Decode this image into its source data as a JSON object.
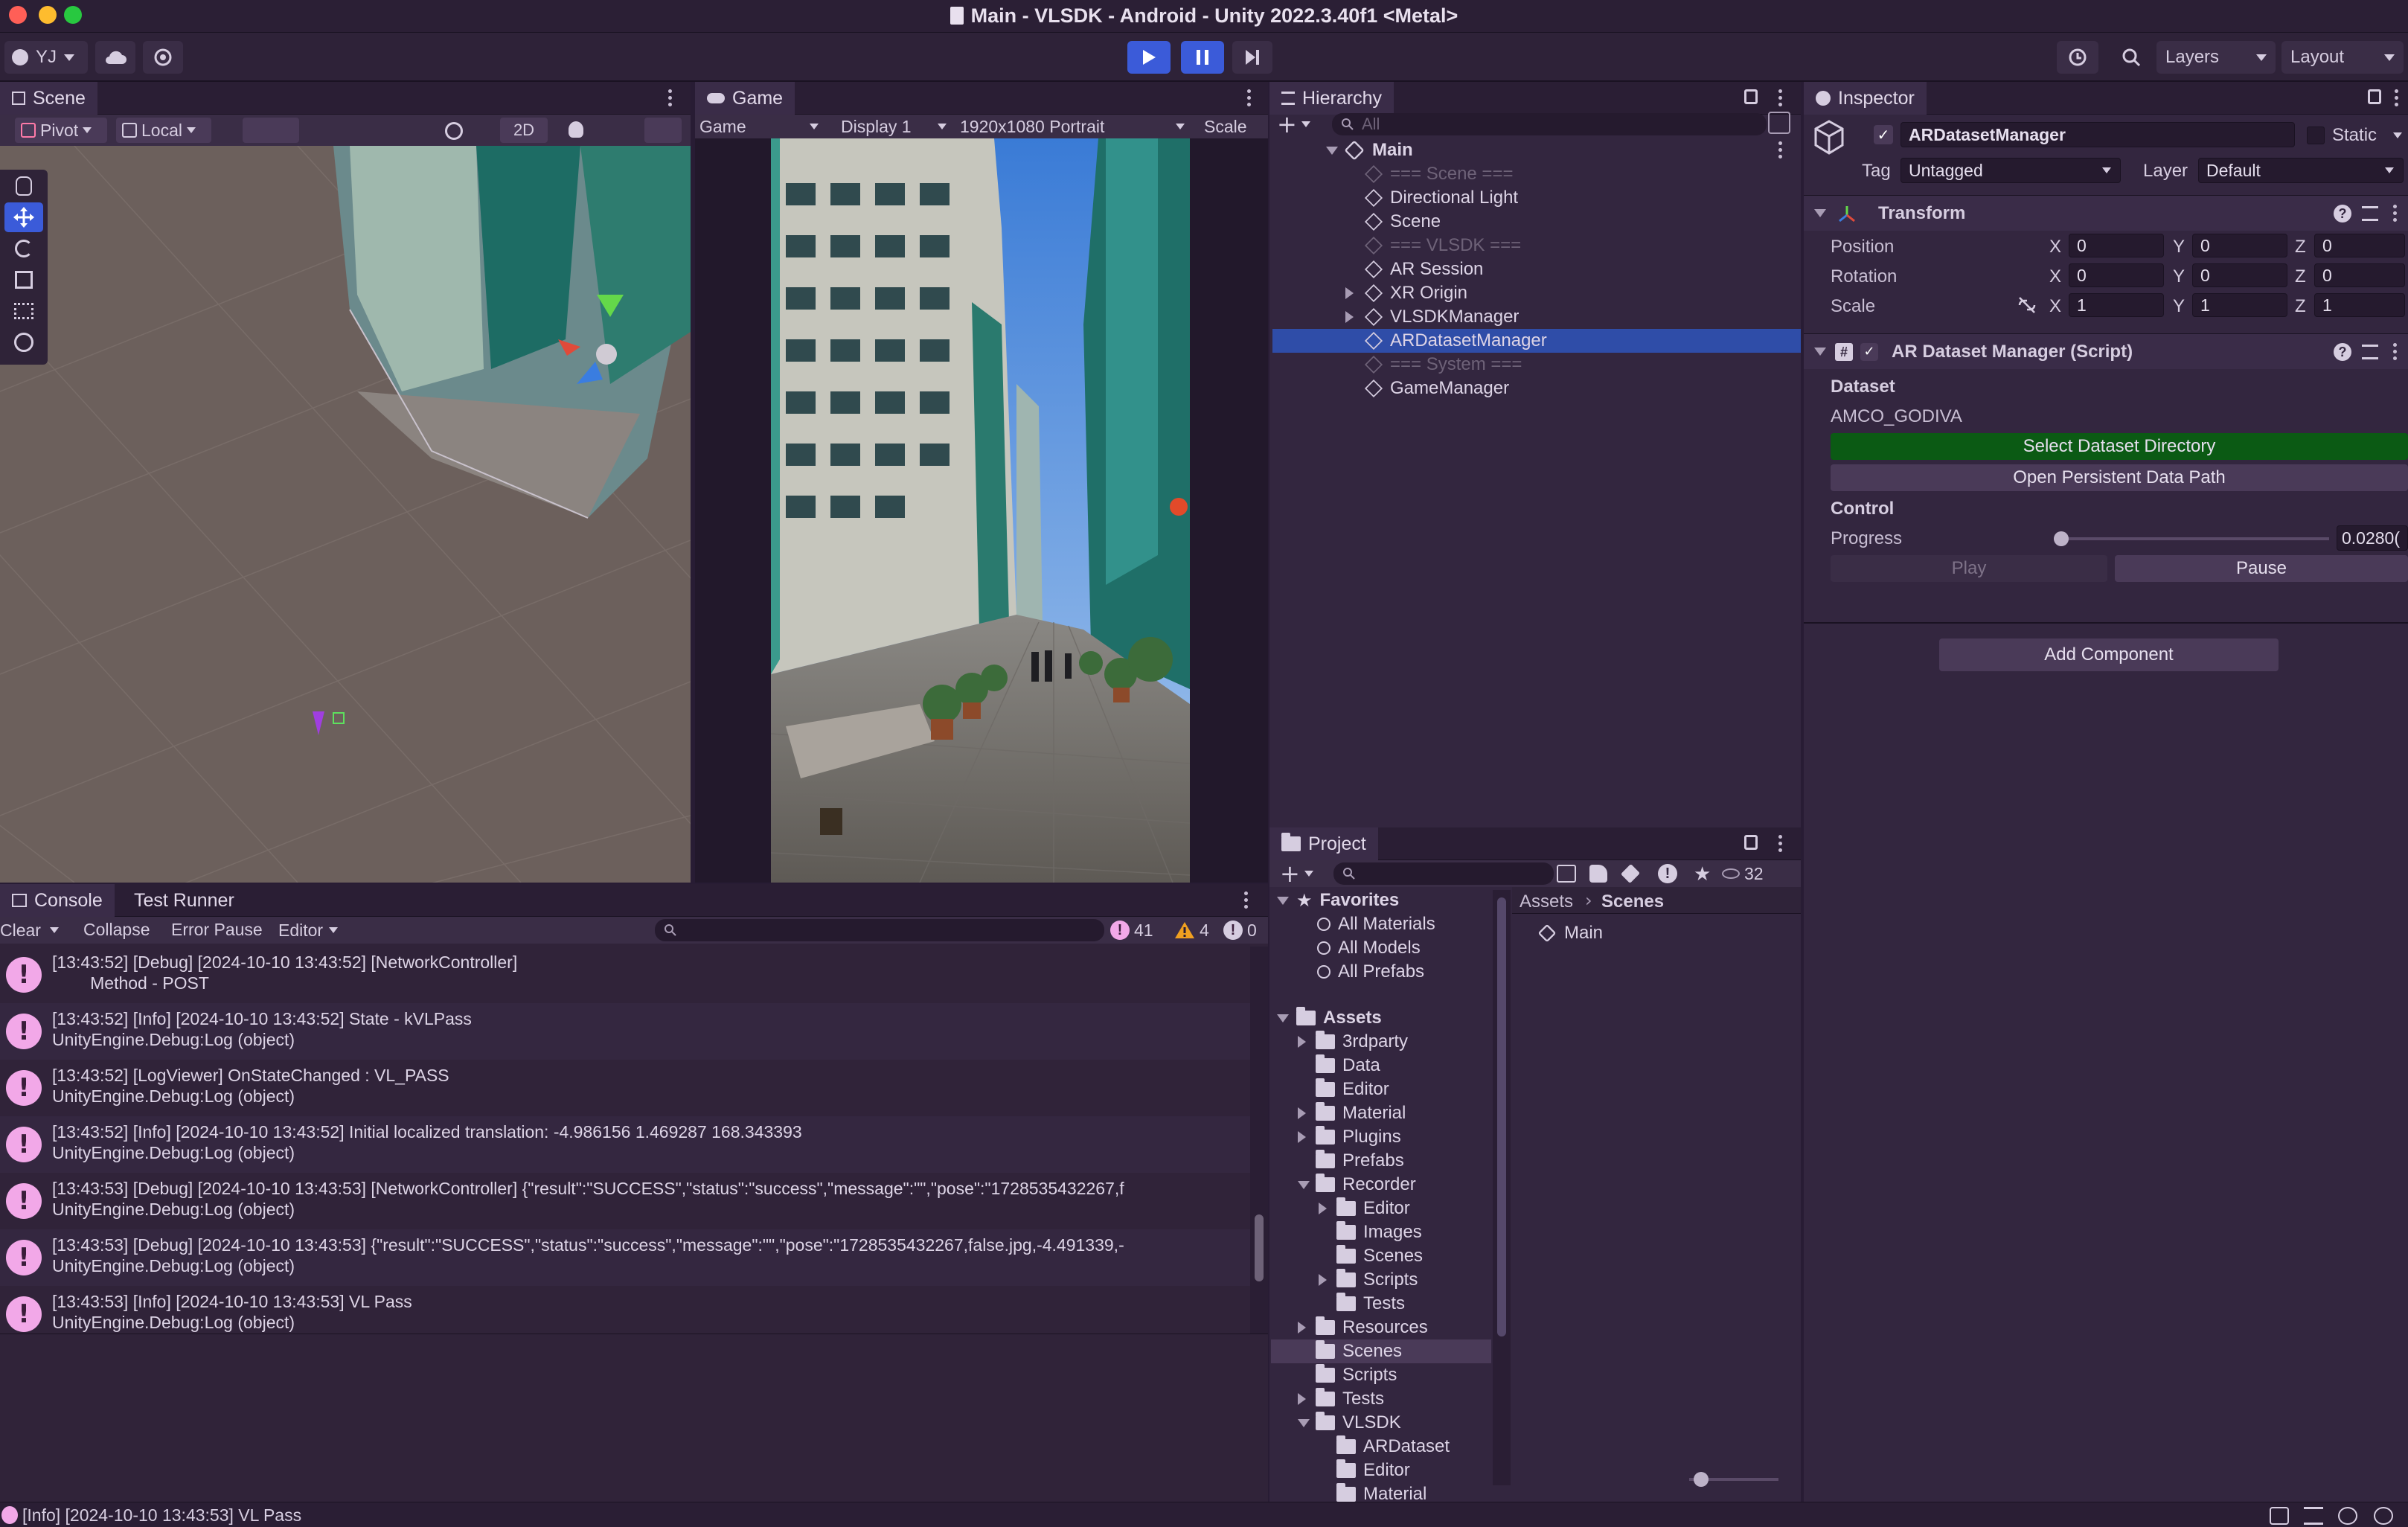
{
  "window": {
    "title": "Main - VLSDK - Android - Unity 2022.3.40f1 <Metal>"
  },
  "toolbar": {
    "account": "YJ",
    "layers_label": "Layers",
    "layout_label": "Layout"
  },
  "scene": {
    "tab": "Scene",
    "pivot": "Pivot",
    "local": "Local",
    "btn_2d": "2D"
  },
  "game": {
    "tab": "Game",
    "mode": "Game",
    "display": "Display 1",
    "resolution": "1920x1080 Portrait",
    "scale_label": "Scale"
  },
  "hierarchy": {
    "tab": "Hierarchy",
    "search_placeholder": "All",
    "root": "Main",
    "items": [
      {
        "label": "=== Scene ===",
        "dim": true
      },
      {
        "label": "Directional Light"
      },
      {
        "label": "Scene"
      },
      {
        "label": "=== VLSDK ===",
        "dim": true
      },
      {
        "label": "AR Session"
      },
      {
        "label": "XR Origin",
        "expandable": true
      },
      {
        "label": "VLSDKManager",
        "expandable": true
      },
      {
        "label": "ARDatasetManager",
        "selected": true
      },
      {
        "label": "=== System ===",
        "dim": true
      },
      {
        "label": "GameManager"
      }
    ]
  },
  "inspector": {
    "tab": "Inspector",
    "object_name": "ARDatasetManager",
    "static_label": "Static",
    "tag_label": "Tag",
    "tag_value": "Untagged",
    "layer_label": "Layer",
    "layer_value": "Default",
    "transform": {
      "title": "Transform",
      "rows": [
        {
          "label": "Position",
          "x": "0",
          "y": "0",
          "z": "0"
        },
        {
          "label": "Rotation",
          "x": "0",
          "y": "0",
          "z": "0"
        },
        {
          "label": "Scale",
          "x": "1",
          "y": "1",
          "z": "1"
        }
      ],
      "axis_x": "X",
      "axis_y": "Y",
      "axis_z": "Z"
    },
    "script": {
      "title": "AR Dataset Manager (Script)",
      "dataset_header": "Dataset",
      "dataset_value": "AMCO_GODIVA",
      "select_dir_button": "Select Dataset Directory",
      "open_path_button": "Open Persistent Data Path",
      "control_header": "Control",
      "progress_label": "Progress",
      "progress_value": "0.0280(",
      "progress_fraction": 0.028,
      "play_button": "Play",
      "pause_button": "Pause"
    },
    "add_component": "Add Component"
  },
  "console": {
    "tab": "Console",
    "tab2": "Test Runner",
    "clear": "Clear",
    "collapse": "Collapse",
    "error_pause": "Error Pause",
    "editor": "Editor",
    "count_log": "41",
    "count_warn": "4",
    "count_err": "0",
    "entries": [
      {
        "line1": "[13:43:52] [Debug] [2024-10-10 13:43:52] [NetworkController]",
        "line2": "        Method - POST"
      },
      {
        "line1": "[13:43:52] [Info] [2024-10-10 13:43:52] State - kVLPass",
        "line2": "UnityEngine.Debug:Log (object)"
      },
      {
        "line1": "[13:43:52] [LogViewer] OnStateChanged : VL_PASS",
        "line2": "UnityEngine.Debug:Log (object)"
      },
      {
        "line1": "[13:43:52] [Info] [2024-10-10 13:43:52] Initial localized translation: -4.986156 1.469287 168.343393",
        "line2": "UnityEngine.Debug:Log (object)"
      },
      {
        "line1": "[13:43:53] [Debug] [2024-10-10 13:43:53] [NetworkController] {\"result\":\"SUCCESS\",\"status\":\"success\",\"message\":\"\",\"pose\":\"1728535432267,f",
        "line2": "UnityEngine.Debug:Log (object)"
      },
      {
        "line1": "[13:43:53] [Debug] [2024-10-10 13:43:53] {\"result\":\"SUCCESS\",\"status\":\"success\",\"message\":\"\",\"pose\":\"1728535432267,false.jpg,-4.491339,-",
        "line2": "UnityEngine.Debug:Log (object)"
      },
      {
        "line1": "[13:43:53] [Info] [2024-10-10 13:43:53] VL Pass",
        "line2": "UnityEngine.Debug:Log (object)"
      }
    ]
  },
  "project": {
    "tab": "Project",
    "hidden_count": "32",
    "favorites": "Favorites",
    "fav_items": [
      "All Materials",
      "All Models",
      "All Prefabs"
    ],
    "assets": "Assets",
    "tree": [
      {
        "label": "3rdparty",
        "depth": 1,
        "arrow": "right"
      },
      {
        "label": "Data",
        "depth": 1,
        "arrow": "none"
      },
      {
        "label": "Editor",
        "depth": 1,
        "arrow": "none"
      },
      {
        "label": "Material",
        "depth": 1,
        "arrow": "right"
      },
      {
        "label": "Plugins",
        "depth": 1,
        "arrow": "right"
      },
      {
        "label": "Prefabs",
        "depth": 1,
        "arrow": "none"
      },
      {
        "label": "Recorder",
        "depth": 1,
        "arrow": "down"
      },
      {
        "label": "Editor",
        "depth": 2,
        "arrow": "right"
      },
      {
        "label": "Images",
        "depth": 2,
        "arrow": "none"
      },
      {
        "label": "Scenes",
        "depth": 2,
        "arrow": "none"
      },
      {
        "label": "Scripts",
        "depth": 2,
        "arrow": "right"
      },
      {
        "label": "Tests",
        "depth": 2,
        "arrow": "none"
      },
      {
        "label": "Resources",
        "depth": 1,
        "arrow": "right"
      },
      {
        "label": "Scenes",
        "depth": 1,
        "arrow": "none",
        "selected": true
      },
      {
        "label": "Scripts",
        "depth": 1,
        "arrow": "none"
      },
      {
        "label": "Tests",
        "depth": 1,
        "arrow": "right"
      },
      {
        "label": "VLSDK",
        "depth": 1,
        "arrow": "down"
      },
      {
        "label": "ARDataset",
        "depth": 2,
        "arrow": "none"
      },
      {
        "label": "Editor",
        "depth": 2,
        "arrow": "none"
      },
      {
        "label": "Material",
        "depth": 2,
        "arrow": "none"
      }
    ],
    "breadcrumb_root": "Assets",
    "breadcrumb_current": "Scenes",
    "content_items": [
      "Main"
    ]
  },
  "statusbar": {
    "message": "[Info] [2024-10-10 13:43:53] VL Pass"
  },
  "colors": {
    "accent_blue": "#2f4da8",
    "play_blue": "#3b5bd9",
    "green_button": "#0b5a14",
    "panel": "#33263f",
    "console_icon": "#f2a8e8"
  }
}
